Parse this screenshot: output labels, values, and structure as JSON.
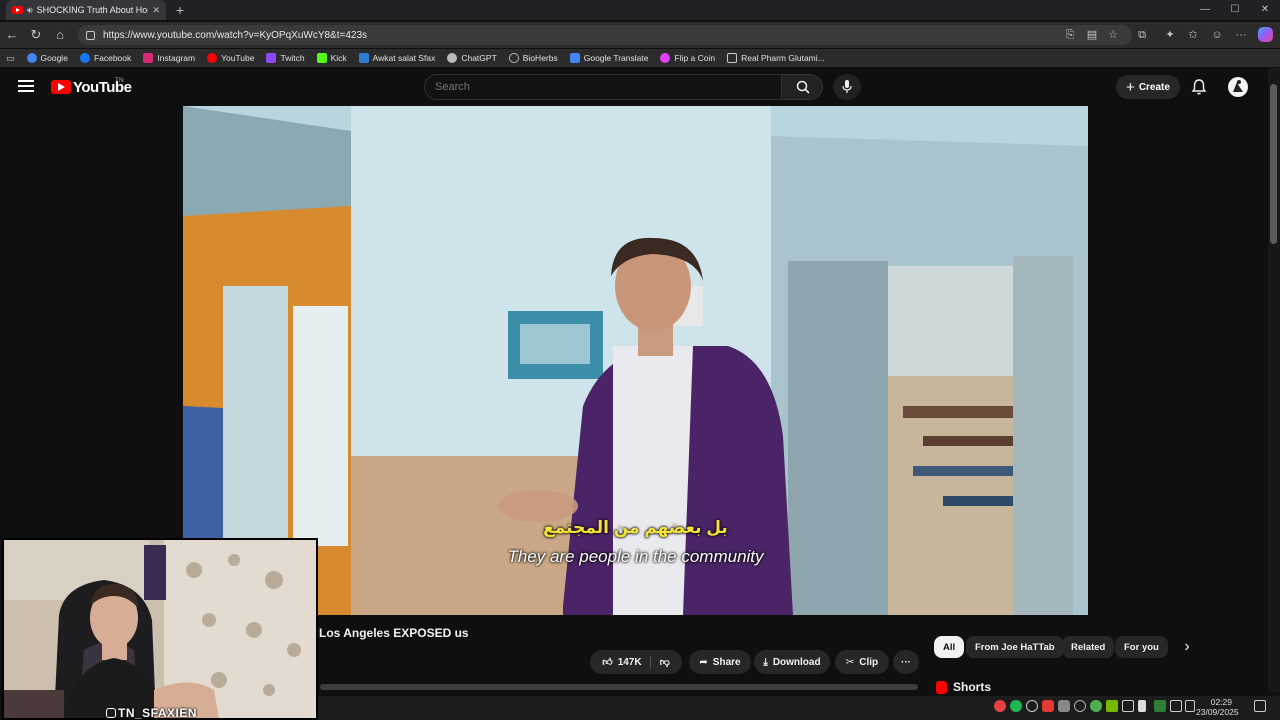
{
  "browser": {
    "tab_title": "SHOCKING Truth About Home",
    "new_tab": "+",
    "url": "https://www.youtube.com/watch?v=KyOPqXuWcY8&t=423s",
    "window_controls": [
      "—",
      "☐",
      "✕"
    ]
  },
  "bookmarks": [
    {
      "label": "Google",
      "color": "#4285f4"
    },
    {
      "label": "Facebook",
      "color": "#1877f2"
    },
    {
      "label": "Instagram",
      "color": "#d62976"
    },
    {
      "label": "YouTube",
      "color": "#ff0000"
    },
    {
      "label": "Twitch",
      "color": "#9146ff"
    },
    {
      "label": "Kick",
      "color": "#53fc18"
    },
    {
      "label": "Awkat salat Sfax",
      "color": "#2d7dd2"
    },
    {
      "label": "ChatGPT",
      "color": "#bbbbbb"
    },
    {
      "label": "BioHerbs",
      "color": "#bbbbbb"
    },
    {
      "label": "Google Translate",
      "color": "#4285f4"
    },
    {
      "label": "Flip a Coin",
      "color": "#e040fb"
    },
    {
      "label": "Real Pharm Glutami...",
      "color": "#cccccc"
    }
  ],
  "youtube": {
    "logo_text": "YouTube",
    "country": "TN",
    "search_placeholder": "Search",
    "create_label": "Create"
  },
  "video": {
    "subtitle_ar": "بل بعضهم من المجتمع",
    "subtitle_en": "They are people in the community",
    "title": "Los Angeles EXPOSED us"
  },
  "actions": {
    "likes": "147K",
    "share": "Share",
    "download": "Download",
    "clip": "Clip",
    "more": "···"
  },
  "chips": [
    {
      "label": "All",
      "active": true
    },
    {
      "label": "From Joe HaTTab",
      "active": false
    },
    {
      "label": "Related",
      "active": false
    },
    {
      "label": "For you",
      "active": false
    }
  ],
  "chips_next": "›",
  "shorts_label": "Shorts",
  "webcam": {
    "tag": "TN_SFAXIEN"
  },
  "taskbar": {
    "time": "02:29",
    "date": "23/09/2025"
  }
}
